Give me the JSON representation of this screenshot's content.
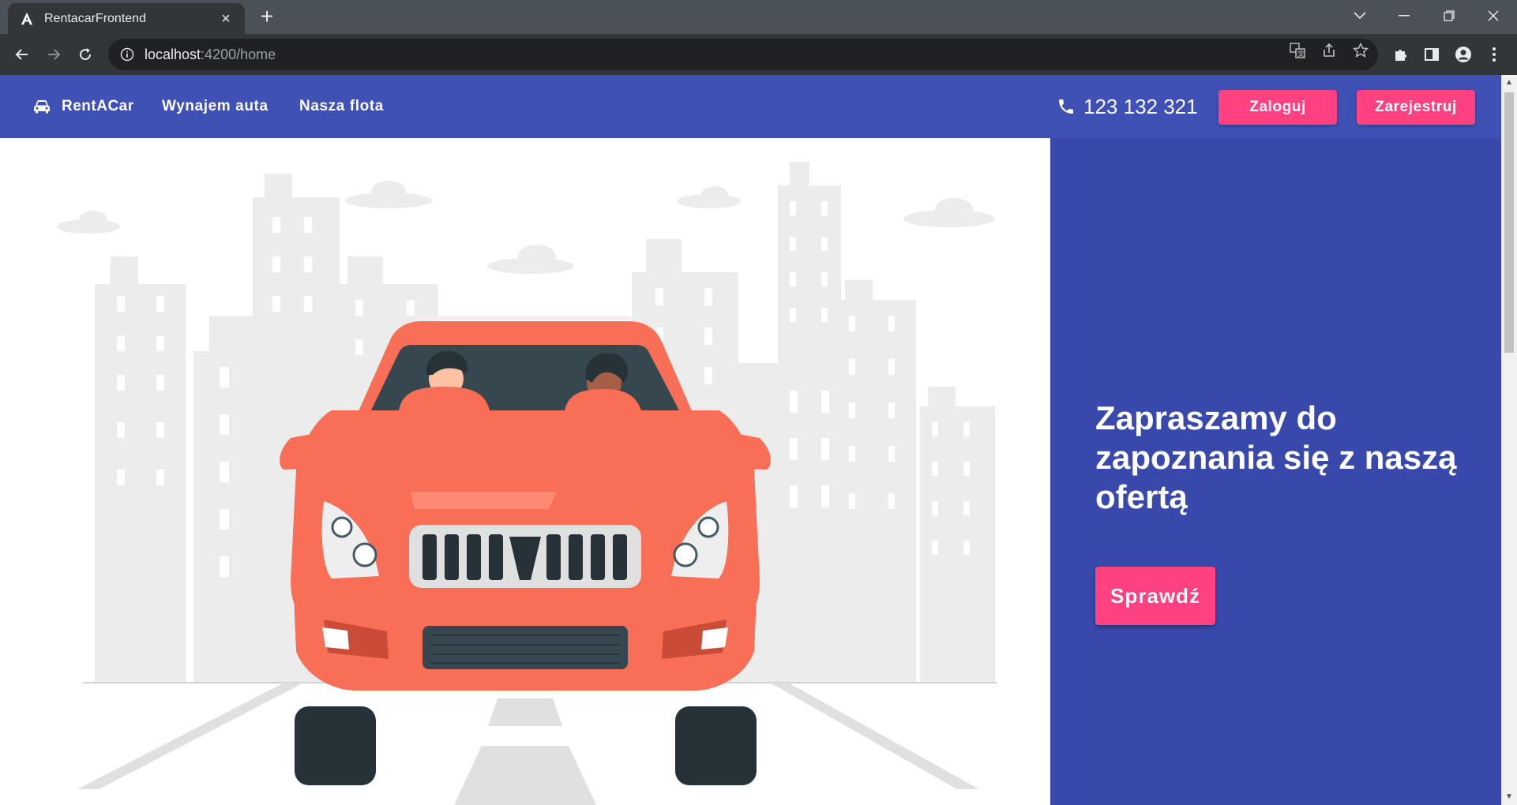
{
  "browser": {
    "tab_title": "RentacarFrontend",
    "url_host": "localhost",
    "url_rest": ":4200/home"
  },
  "navbar": {
    "brand": "RentACar",
    "links": [
      "Wynajem auta",
      "Nasza flota"
    ],
    "phone": "123 132 321",
    "login_label": "Zaloguj",
    "register_label": "Zarejestruj"
  },
  "hero": {
    "heading": "Zapraszamy do zapoznania się z naszą ofertą",
    "cta_label": "Sprawdź"
  },
  "colors": {
    "primary": "#3f51b5",
    "hero_panel": "#3949ab",
    "accent": "#ff4081",
    "car_body": "#f96e56",
    "car_dark": "#263238"
  },
  "icons": {
    "brand": "car-icon",
    "phone": "phone-icon"
  }
}
